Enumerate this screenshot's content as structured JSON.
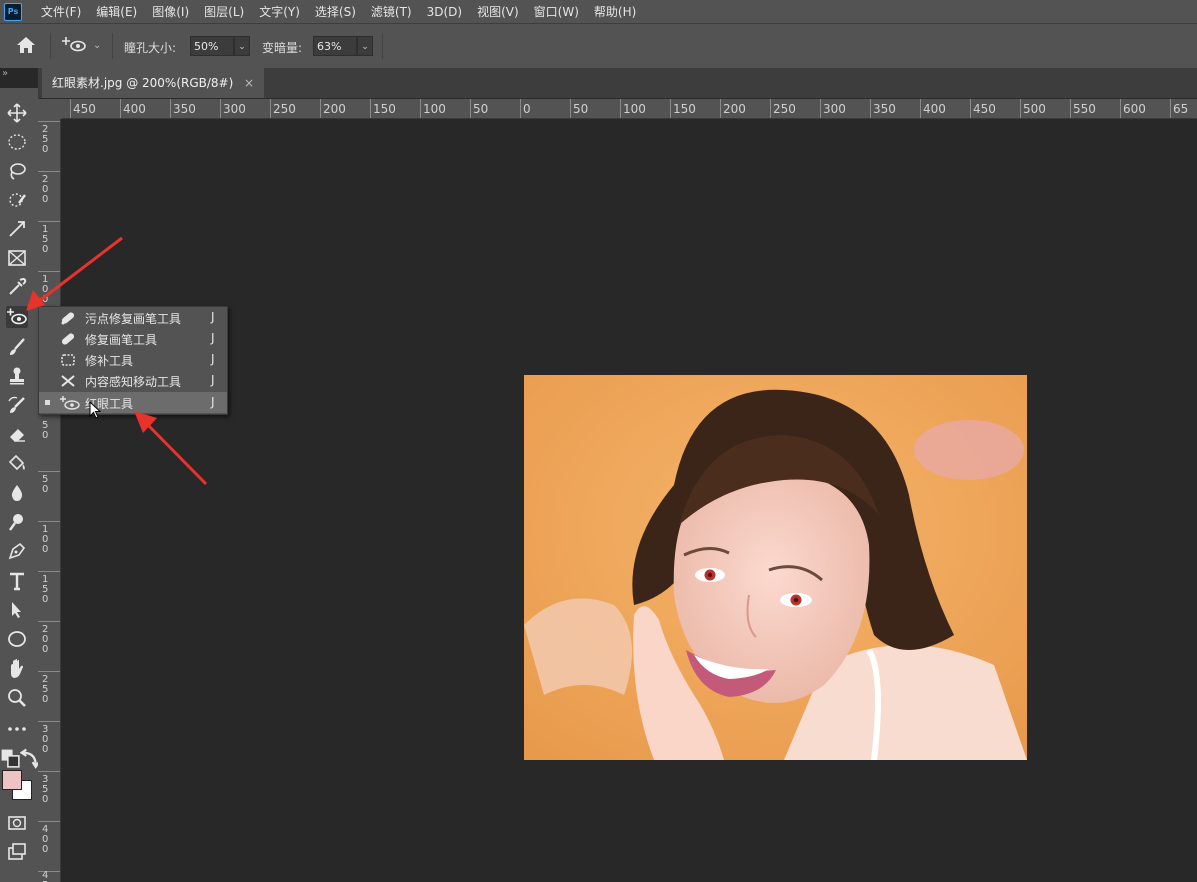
{
  "app": {
    "logo": "Ps"
  },
  "menu": [
    "文件(F)",
    "编辑(E)",
    "图像(I)",
    "图层(L)",
    "文字(Y)",
    "选择(S)",
    "滤镜(T)",
    "3D(D)",
    "视图(V)",
    "窗口(W)",
    "帮助(H)"
  ],
  "options": {
    "pupil_size_label": "瞳孔大小:",
    "pupil_size_value": "50%",
    "darken_label": "变暗量:",
    "darken_value": "63%"
  },
  "panel_collapse": "»",
  "document": {
    "tab_title": "红眼素材.jpg @ 200%(RGB/8#)",
    "close": "×"
  },
  "ruler_h": [
    "450",
    "400",
    "350",
    "300",
    "250",
    "200",
    "150",
    "100",
    "50",
    "0",
    "50",
    "100",
    "150",
    "200",
    "250",
    "300",
    "350",
    "400",
    "450",
    "500",
    "550",
    "600",
    "65"
  ],
  "ruler_v": [
    "250",
    "200",
    "150",
    "100",
    "50",
    "0",
    "50",
    "100",
    "150",
    "200",
    "250",
    "300",
    "350",
    "400",
    "450"
  ],
  "flyout": {
    "items": [
      {
        "label": "污点修复画笔工具",
        "key": "J",
        "icon": "spot-healing-icon"
      },
      {
        "label": "修复画笔工具",
        "key": "J",
        "icon": "healing-brush-icon"
      },
      {
        "label": "修补工具",
        "key": "J",
        "icon": "patch-icon"
      },
      {
        "label": "内容感知移动工具",
        "key": "J",
        "icon": "content-aware-move-icon"
      },
      {
        "label": "红眼工具",
        "key": "J",
        "icon": "red-eye-icon",
        "selected": true
      }
    ]
  },
  "colors": {
    "foreground": "#eec3c3",
    "background": "#ffffff",
    "annotation": "#e8322c"
  }
}
